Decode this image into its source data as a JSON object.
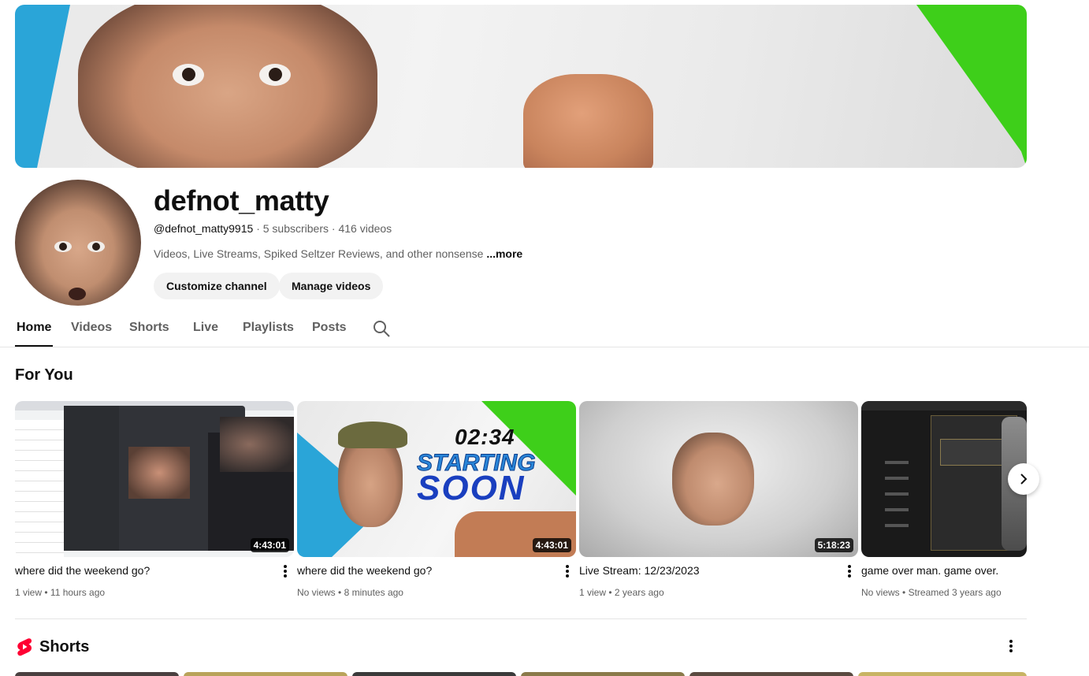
{
  "channel": {
    "name": "defnot_matty",
    "handle": "@defnot_matty9915",
    "subscribers": "5 subscribers",
    "videos_count": "416 videos",
    "separator": "·",
    "description": "Videos, Live Streams, Spiked Seltzer Reviews, and other nonsense",
    "more_label": "...more"
  },
  "actions": {
    "customize_label": "Customize channel",
    "manage_label": "Manage videos"
  },
  "tabs": [
    {
      "label": "Home",
      "active": true
    },
    {
      "label": "Videos",
      "active": false
    },
    {
      "label": "Shorts",
      "active": false
    },
    {
      "label": "Live",
      "active": false
    },
    {
      "label": "Playlists",
      "active": false
    },
    {
      "label": "Posts",
      "active": false
    }
  ],
  "for_you": {
    "title": "For You",
    "videos": [
      {
        "title": "where did the weekend go?",
        "duration": "4:43:01",
        "views": "1 view",
        "age": "11 hours ago"
      },
      {
        "title": "where did the weekend go?",
        "duration": "4:43:01",
        "views": "No views",
        "age": "8 minutes ago",
        "thumb_time": "02:34",
        "thumb_line1": "STARTING",
        "thumb_line2": "SOON"
      },
      {
        "title": "Live Stream: 12/23/2023",
        "duration": "5:18:23",
        "views": "1 view",
        "age": "2 years ago"
      },
      {
        "title": "game over man. game over.",
        "views": "No views",
        "age": "Streamed 3 years ago"
      }
    ],
    "meta_separator": "•"
  },
  "shorts": {
    "title": "Shorts"
  },
  "icons": {
    "search": "search-icon",
    "next": "chevron-right-icon",
    "more": "more-vert-icon",
    "shorts": "shorts-logo-icon"
  },
  "colors": {
    "text_primary": "#0f0f0f",
    "text_secondary": "#606060",
    "button_bg": "#f2f2f2",
    "shorts_red": "#ff0033",
    "banner_green": "#3ecf1a",
    "banner_blue": "#2aa5d8"
  }
}
